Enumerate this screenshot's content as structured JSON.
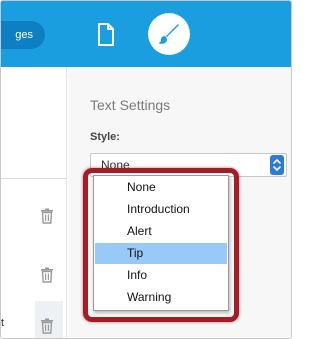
{
  "header": {
    "changes_button_label": "ges",
    "tabs": [
      {
        "icon": "page-icon"
      },
      {
        "icon": "brush-icon",
        "active": true
      }
    ]
  },
  "left_panel": {
    "row_snippet": "t"
  },
  "text_settings": {
    "title": "Text Settings",
    "style_label": "Style:",
    "style_value": "None",
    "options": [
      {
        "label": "None",
        "selected": false
      },
      {
        "label": "Introduction",
        "selected": false
      },
      {
        "label": "Alert",
        "selected": false
      },
      {
        "label": "Tip",
        "selected": true
      },
      {
        "label": "Info",
        "selected": false
      },
      {
        "label": "Warning",
        "selected": false
      }
    ]
  },
  "colors": {
    "header_blue": "#1a9ee0",
    "highlight_red": "#a51d24",
    "selected_option": "#99c9f7",
    "select_arrow_blue": "#2b7bd8"
  }
}
